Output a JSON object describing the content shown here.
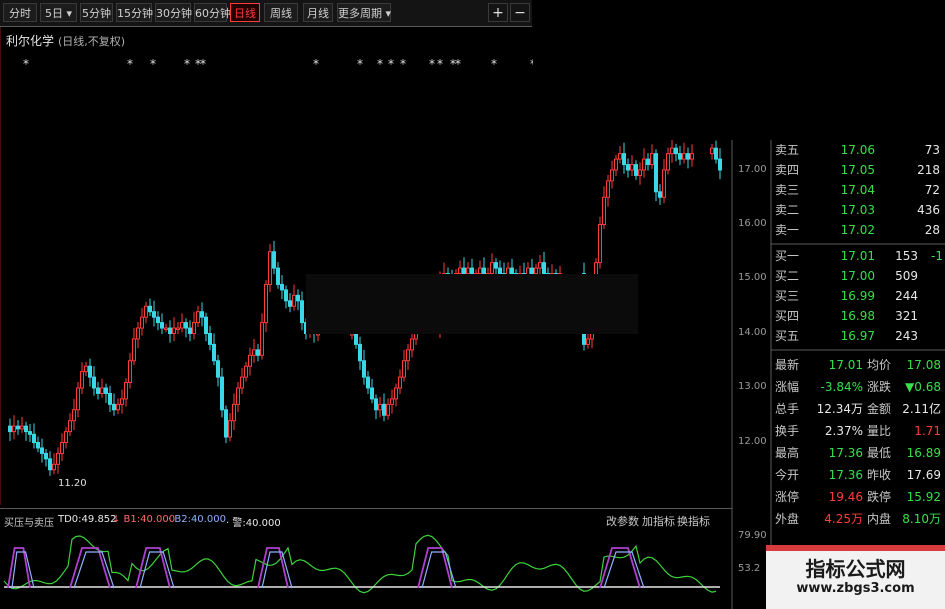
{
  "toolbar": {
    "tabs": [
      {
        "label": "分时",
        "active": false
      },
      {
        "label": "5日 ▾",
        "active": false
      },
      {
        "label": "5分钟",
        "active": false
      },
      {
        "label": "15分钟",
        "active": false
      },
      {
        "label": "30分钟",
        "active": false
      },
      {
        "label": "60分钟",
        "active": false
      },
      {
        "label": "日线",
        "active": true
      },
      {
        "label": "周线",
        "active": false
      },
      {
        "label": "月线",
        "active": false
      },
      {
        "label": "更多周期 ▾",
        "active": false
      }
    ],
    "zoom_in": "+",
    "zoom_out": "−"
  },
  "stock": {
    "name": "利尔化学",
    "mode": "(日线,不复权)"
  },
  "price_axis": [
    "17.00",
    "16.00",
    "15.00",
    "14.00",
    "13.00",
    "12.00"
  ],
  "low_marker": "11.20",
  "order_book": {
    "asks": [
      {
        "label": "卖五",
        "price": "17.06",
        "vol": "73"
      },
      {
        "label": "卖四",
        "price": "17.05",
        "vol": "218"
      },
      {
        "label": "卖三",
        "price": "17.04",
        "vol": "72"
      },
      {
        "label": "卖二",
        "price": "17.03",
        "vol": "436"
      },
      {
        "label": "卖一",
        "price": "17.02",
        "vol": "28"
      }
    ],
    "bids": [
      {
        "label": "买一",
        "price": "17.01",
        "vol": "153",
        "change": "-1"
      },
      {
        "label": "买二",
        "price": "17.00",
        "vol": "509"
      },
      {
        "label": "买三",
        "price": "16.99",
        "vol": "244"
      },
      {
        "label": "买四",
        "price": "16.98",
        "vol": "321"
      },
      {
        "label": "买五",
        "price": "16.97",
        "vol": "243"
      }
    ]
  },
  "quote": [
    {
      "l1": "最新",
      "v1": "17.01",
      "c1": "green",
      "l2": "均价",
      "v2": "17.08",
      "c2": "green"
    },
    {
      "l1": "涨幅",
      "v1": "-3.84%",
      "c1": "green",
      "l2": "涨跌",
      "v2": "▼0.68",
      "c2": "green"
    },
    {
      "l1": "总手",
      "v1": "12.34万",
      "c1": "white",
      "l2": "金额",
      "v2": "2.11亿",
      "c2": "white"
    },
    {
      "l1": "换手",
      "v1": "2.37%",
      "c1": "white",
      "l2": "量比",
      "v2": "1.71",
      "c2": "red"
    },
    {
      "l1": "最高",
      "v1": "17.36",
      "c1": "green",
      "l2": "最低",
      "v2": "16.89",
      "c2": "green"
    },
    {
      "l1": "今开",
      "v1": "17.36",
      "c1": "green",
      "l2": "昨收",
      "v2": "17.69",
      "c2": "white"
    },
    {
      "l1": "涨停",
      "v1": "19.46",
      "c1": "red",
      "l2": "跌停",
      "v2": "15.92",
      "c2": "green"
    },
    {
      "l1": "外盘",
      "v1": "4.25万",
      "c1": "red",
      "l2": "内盘",
      "v2": "8.10万",
      "c2": "green"
    }
  ],
  "indicator": {
    "title": "买压与卖压",
    "td": "TD0:49.852",
    "b1": "↓ B1:40.000",
    "b2": "· B2:40.000",
    "sell": "· 警:40.000",
    "buttons": [
      "改参数",
      "加指标",
      "换指标"
    ],
    "axis": [
      "79.90",
      "53.2"
    ]
  },
  "watermark": {
    "main": "指标公式网",
    "sub": "www.zbgs3.com"
  },
  "colors": {
    "up": "#ff3b3b",
    "down": "#3ad7e6",
    "indicator_line": "#3bd23b",
    "band": "#b040d0",
    "band2": "#8fb0ff"
  }
}
